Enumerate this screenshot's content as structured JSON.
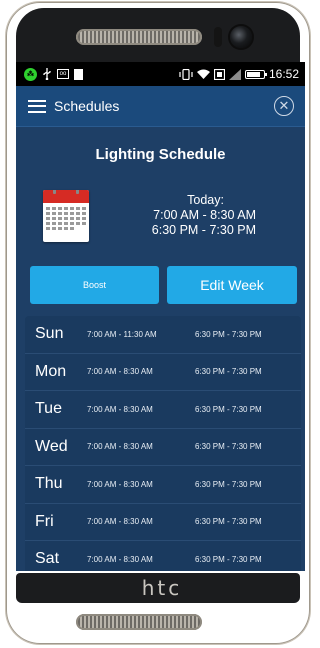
{
  "status_bar": {
    "time": "16:52"
  },
  "app_bar": {
    "title": "Schedules",
    "close_glyph": "✕"
  },
  "schedule_header": {
    "title": "Lighting Schedule",
    "today_label": "Today:",
    "today_slots": [
      "7:00 AM - 8:30 AM",
      "6:30 PM - 7:30 PM"
    ]
  },
  "buttons": {
    "boost_label": "Boost",
    "edit_week_label": "Edit Week"
  },
  "schedule": [
    {
      "day": "Sun",
      "slot1": "7:00 AM - 11:30 AM",
      "slot2": "6:30 PM - 7:30 PM"
    },
    {
      "day": "Mon",
      "slot1": "7:00 AM - 8:30 AM",
      "slot2": "6:30 PM - 7:30 PM"
    },
    {
      "day": "Tue",
      "slot1": "7:00 AM - 8:30 AM",
      "slot2": "6:30 PM - 7:30 PM"
    },
    {
      "day": "Wed",
      "slot1": "7:00 AM - 8:30 AM",
      "slot2": "6:30 PM - 7:30 PM"
    },
    {
      "day": "Thu",
      "slot1": "7:00 AM - 8:30 AM",
      "slot2": "6:30 PM - 7:30 PM"
    },
    {
      "day": "Fri",
      "slot1": "7:00 AM - 8:30 AM",
      "slot2": "6:30 PM - 7:30 PM"
    },
    {
      "day": "Sat",
      "slot1": "7:00 AM - 8:30 AM",
      "slot2": "6:30 PM - 7:30 PM"
    }
  ],
  "device": {
    "brand_logo": "htc"
  },
  "icons": {
    "status_left": [
      "blackberry-icon",
      "usb-icon",
      "voicemail-icon",
      "notification-icon"
    ],
    "status_right": [
      "vibrate-icon",
      "wifi-icon",
      "nfc-icon",
      "signal-icon",
      "battery-icon"
    ],
    "app_bar": [
      "menu-icon",
      "close-icon"
    ],
    "header": [
      "calendar-icon"
    ]
  },
  "colors": {
    "screen_bg": "#1e3f66",
    "app_bar_bg": "#1b4a7c",
    "button_bg": "#22a9e6",
    "schedule_bg": "#1a3a5f",
    "status_bg": "#000000"
  }
}
